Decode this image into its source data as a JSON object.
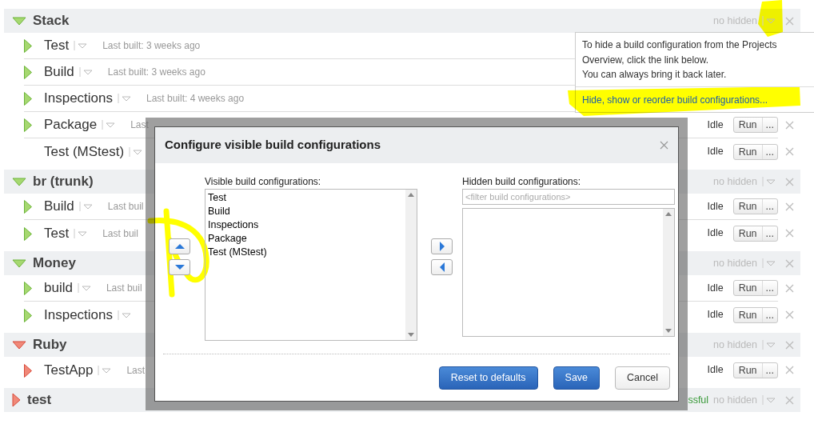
{
  "projects": [
    {
      "name": "Stack",
      "kind": "success",
      "expanded": true,
      "hidden_info": "no hidden",
      "configs": [
        {
          "name": "Test",
          "kind": "success",
          "last_built": "Last built: 3 weeks ago"
        },
        {
          "name": "Build",
          "kind": "success",
          "last_built": "Last built: 3 weeks ago"
        },
        {
          "name": "Inspections",
          "kind": "success",
          "last_built": "Last built: 4 weeks ago"
        },
        {
          "name": "Package",
          "kind": "success",
          "last_built": "Last",
          "state": "Idle",
          "run": "Run",
          "more": "..."
        },
        {
          "name": "Test (MStest)",
          "kind": "none",
          "state": "Idle",
          "run": "Run",
          "more": "..."
        }
      ]
    },
    {
      "name": "br (trunk)",
      "kind": "success",
      "expanded": true,
      "hidden_info": "no hidden",
      "configs": [
        {
          "name": "Build",
          "kind": "success",
          "last_built": "Last buil",
          "state": "Idle",
          "run": "Run",
          "more": "..."
        },
        {
          "name": "Test",
          "kind": "success",
          "last_built": "Last buil",
          "state": "Idle",
          "run": "Run",
          "more": "..."
        }
      ]
    },
    {
      "name": "Money",
      "kind": "success",
      "expanded": true,
      "hidden_info": "no hidden",
      "configs": [
        {
          "name": "build",
          "kind": "success",
          "last_built": "Last buil",
          "state": "Idle",
          "run": "Run",
          "more": "..."
        },
        {
          "name": "Inspections",
          "kind": "success",
          "state": "Idle",
          "run": "Run",
          "more": "..."
        }
      ]
    },
    {
      "name": "Ruby",
      "kind": "failure",
      "expanded": true,
      "hidden_info": "no hidden",
      "configs": [
        {
          "name": "TestApp",
          "kind": "failure",
          "last_built": "Last",
          "state": "Idle",
          "run": "Run",
          "more": "..."
        }
      ]
    },
    {
      "name": "test",
      "kind": "failure",
      "expanded": false,
      "summary": "ssful",
      "hidden_info": "no hidden"
    }
  ],
  "popup": {
    "lines": [
      "To hide a build configuration from the Projects",
      "Overview, click the link below.",
      "You can always bring it back later."
    ],
    "link": "Hide, show or reorder build configurations..."
  },
  "dialog": {
    "title": "Configure visible build configurations",
    "visible_label": "Visible build configurations:",
    "visible_items": [
      "Test",
      "Build",
      "Inspections",
      "Package",
      "Test (MStest)"
    ],
    "hidden_label": "Hidden build configurations:",
    "filter_placeholder": "<filter build configurations>",
    "buttons": [
      {
        "label": "Reset to defaults",
        "kind": "primary"
      },
      {
        "label": "Save",
        "kind": "primary"
      },
      {
        "label": "Cancel",
        "kind": "secondary"
      }
    ]
  }
}
